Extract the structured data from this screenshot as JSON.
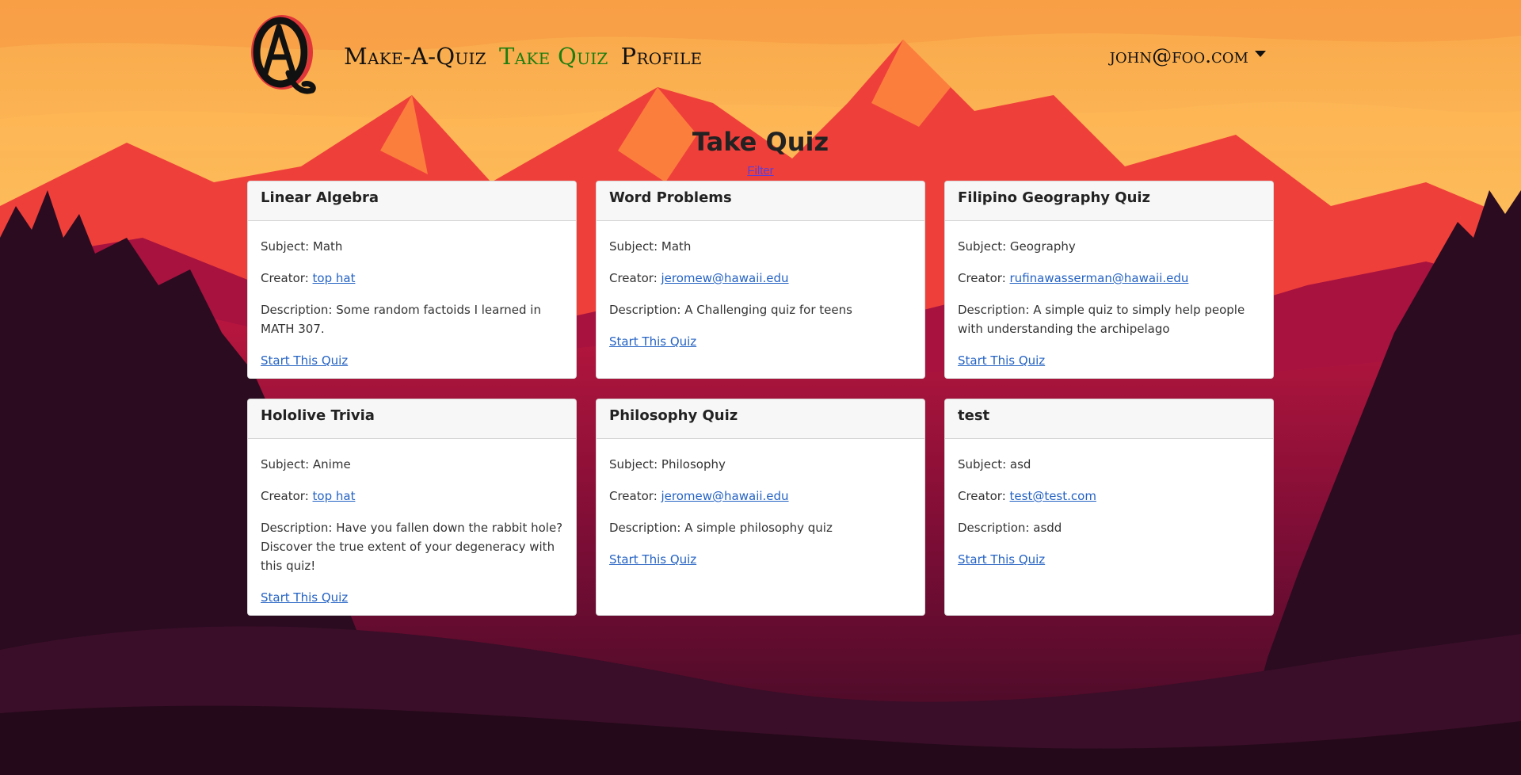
{
  "nav": {
    "links": [
      {
        "label": "Make-A-Quiz",
        "active": false
      },
      {
        "label": "Take Quiz",
        "active": true
      },
      {
        "label": "Profile",
        "active": false
      }
    ],
    "user_email": "john@foo.com"
  },
  "page": {
    "title": "Take Quiz",
    "filter_label": "Filter"
  },
  "labels": {
    "subject": "Subject: ",
    "creator": "Creator: ",
    "description": "Description: ",
    "start": "Start This Quiz"
  },
  "quizzes": [
    {
      "title": "Linear Algebra",
      "subject": "Math",
      "creator": "top hat",
      "description": "Some random factoids I learned in MATH 307."
    },
    {
      "title": "Word Problems",
      "subject": "Math",
      "creator": "jeromew@hawaii.edu",
      "description": "A Challenging quiz for teens"
    },
    {
      "title": "Filipino Geography Quiz",
      "subject": "Geography",
      "creator": "rufinawasserman@hawaii.edu",
      "description": "A simple quiz to simply help people with understanding the archipelago"
    },
    {
      "title": "Hololive Trivia",
      "subject": "Anime",
      "creator": "top hat",
      "description": "Have you fallen down the rabbit hole? Discover the true extent of your degeneracy with this quiz!"
    },
    {
      "title": "Philosophy Quiz",
      "subject": "Philosophy",
      "creator": "jeromew@hawaii.edu",
      "description": "A simple philosophy quiz"
    },
    {
      "title": "test",
      "subject": "asd",
      "creator": "test@test.com",
      "description": "asdd"
    }
  ],
  "colors": {
    "active_nav": "#1e7d10",
    "link": "#2563c4",
    "filter_link": "#5b3fd6"
  }
}
